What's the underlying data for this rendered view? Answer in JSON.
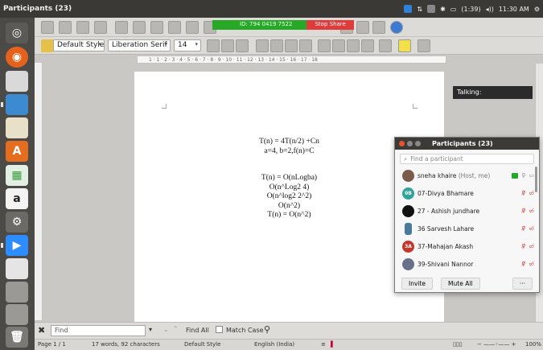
{
  "window": {
    "title": "Participants (23)"
  },
  "tray": {
    "battery": "(1:39)",
    "time": "11:30 AM"
  },
  "zoom": {
    "meeting_id": "ID: 794 0419 7522",
    "stop_share": "Stop Share"
  },
  "toolbar": {
    "paragraph_style": "Default Style",
    "font_name": "Liberation Serif",
    "font_size": "14"
  },
  "ruler": {
    "ticks": "1 · 1 · 2 · 3 · 4 · 5 · 6 · 7 · 8 · 9 · 10 · 11 · 12 · 13 · 14 · 15 · 16 · 17 · 18"
  },
  "document": {
    "lines": [
      "T(n) = 4T(n/2) +Cn",
      "a=4, b=2,f(n)=C",
      "",
      "",
      "T(n) = O(nLogba)",
      "O(n^Log2 4)",
      "O(n^log2 2^2)",
      "O(n^2)",
      "T(n) = O(n^2)"
    ]
  },
  "talking": {
    "label": "Talking:"
  },
  "participants": {
    "title": "Participants (23)",
    "search_placeholder": "Find a participant",
    "rows": [
      {
        "initials": "",
        "name": "sneha khaire",
        "role": "(Host, me)",
        "color": "#7b5a4a"
      },
      {
        "initials": "0B",
        "name": "07-Divya Bhamare",
        "role": "",
        "color": "#2fa39a"
      },
      {
        "initials": "",
        "name": "27 - Ashish jundhare",
        "role": "",
        "color": "#111111"
      },
      {
        "initials": "",
        "name": "36 Sarvesh Lahare",
        "role": "",
        "color": "#4a7a9a"
      },
      {
        "initials": "3A",
        "name": "37-Mahajan Akash",
        "role": "",
        "color": "#c0392b"
      },
      {
        "initials": "",
        "name": "39-Shivani Nannor",
        "role": "",
        "color": "#6a6f8a"
      }
    ],
    "invite_label": "Invite",
    "mute_all_label": "Mute All",
    "more_label": "···"
  },
  "findbar": {
    "input_value": "Find",
    "find_all_label": "Find All",
    "match_case_label": "Match Case"
  },
  "status": {
    "page": "Page 1 / 1",
    "words": "17 words, 92 characters",
    "style": "Default Style",
    "language": "English (India)",
    "zoom": "100%"
  },
  "colors": {
    "accent": "#2f80d8",
    "zoom_green": "#27a827",
    "zoom_red": "#e03b3b"
  }
}
